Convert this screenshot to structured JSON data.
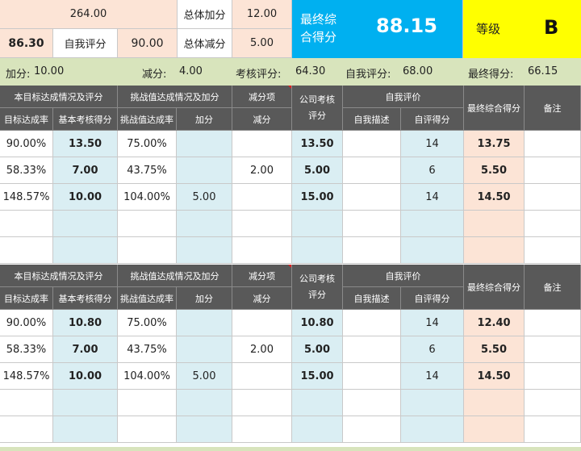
{
  "top": {
    "total_top": "264.00",
    "score_left": "86.30",
    "self_eval_label": "自我评分",
    "self_eval_value": "90.00",
    "total_add_label": "总体加分",
    "total_add_value": "12.00",
    "total_sub_label": "总体减分",
    "total_sub_value": "5.00",
    "final_label": "最终综合得分",
    "final_value": "88.15",
    "grade_label": "等级",
    "grade_value": "B"
  },
  "summary": {
    "add_label": "加分:",
    "add_value": "10.00",
    "sub_label": "减分:",
    "sub_value": "4.00",
    "assess_label": "考核评分:",
    "assess_value": "64.30",
    "self_label": "自我评分:",
    "self_value": "68.00",
    "final_label": "最终得分:",
    "final_value": "66.15"
  },
  "headers": {
    "g_basic": "本目标达成情况及评分",
    "g_challenge": "挑战值达成情况及加分",
    "g_deduct": "减分项",
    "company": "公司考核评分",
    "g_self": "自我评价",
    "final": "最终综合得分",
    "remark": "备注",
    "c_rate": "目标达成率",
    "c_basic": "基本考核得分",
    "c_crate": "挑战值达成率",
    "c_add": "加分",
    "c_sub": "减分",
    "c_desc": "自我描述",
    "c_self": "自评得分"
  },
  "blocks": [
    {
      "rows": [
        {
          "rate": "90.00%",
          "basic": "13.50",
          "crate": "75.00%",
          "add": "",
          "sub": "",
          "company": "13.50",
          "desc": "",
          "self": "14",
          "final": "13.75",
          "remark": ""
        },
        {
          "rate": "58.33%",
          "basic": "7.00",
          "crate": "43.75%",
          "add": "",
          "sub": "2.00",
          "company": "5.00",
          "desc": "",
          "self": "6",
          "final": "5.50",
          "remark": ""
        },
        {
          "rate": "148.57%",
          "basic": "10.00",
          "crate": "104.00%",
          "add": "5.00",
          "sub": "",
          "company": "15.00",
          "desc": "",
          "self": "14",
          "final": "14.50",
          "remark": ""
        },
        {
          "rate": "",
          "basic": "",
          "crate": "",
          "add": "",
          "sub": "",
          "company": "",
          "desc": "",
          "self": "",
          "final": "",
          "remark": ""
        },
        {
          "rate": "",
          "basic": "",
          "crate": "",
          "add": "",
          "sub": "",
          "company": "",
          "desc": "",
          "self": "",
          "final": "",
          "remark": ""
        }
      ]
    },
    {
      "rows": [
        {
          "rate": "90.00%",
          "basic": "10.80",
          "crate": "75.00%",
          "add": "",
          "sub": "",
          "company": "10.80",
          "desc": "",
          "self": "14",
          "final": "12.40",
          "remark": ""
        },
        {
          "rate": "58.33%",
          "basic": "7.00",
          "crate": "43.75%",
          "add": "",
          "sub": "2.00",
          "company": "5.00",
          "desc": "",
          "self": "6",
          "final": "5.50",
          "remark": ""
        },
        {
          "rate": "148.57%",
          "basic": "10.00",
          "crate": "104.00%",
          "add": "5.00",
          "sub": "",
          "company": "15.00",
          "desc": "",
          "self": "14",
          "final": "14.50",
          "remark": ""
        },
        {
          "rate": "",
          "basic": "",
          "crate": "",
          "add": "",
          "sub": "",
          "company": "",
          "desc": "",
          "self": "",
          "final": "",
          "remark": ""
        },
        {
          "rate": "",
          "basic": "",
          "crate": "",
          "add": "",
          "sub": "",
          "company": "",
          "desc": "",
          "self": "",
          "final": "",
          "remark": ""
        }
      ]
    }
  ],
  "colors": {
    "peach": "#fce4d6",
    "light_blue": "#daeef3",
    "header_gray": "#595959",
    "summary_green": "#d8e4bc",
    "final_blue": "#00b0f0",
    "grade_yellow": "#ffff00",
    "deduct_marker_red": "#e02020"
  }
}
